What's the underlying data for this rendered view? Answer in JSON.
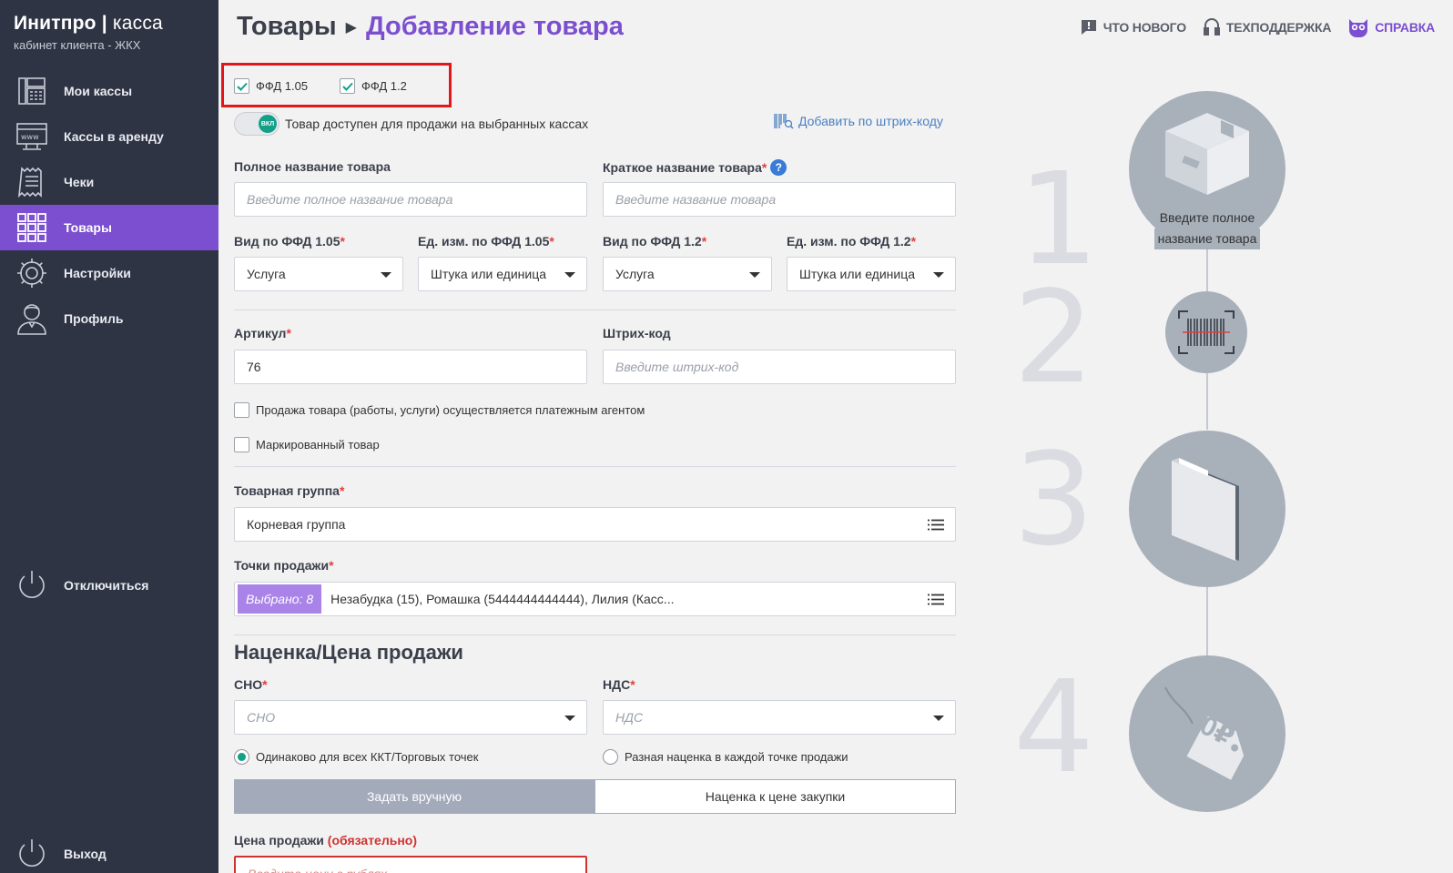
{
  "brand": {
    "name_bold": "Инитпро",
    "name_sep": "|",
    "name_thin": "касса",
    "subtitle": "кабинет клиента - ЖКХ"
  },
  "sidebar": {
    "items": [
      {
        "label": "Мои кассы",
        "icon": "cash-register-icon"
      },
      {
        "label": "Кассы в аренду",
        "icon": "www-terminal-icon"
      },
      {
        "label": "Чеки",
        "icon": "receipt-icon"
      },
      {
        "label": "Товары",
        "icon": "grid-icon",
        "active": true
      },
      {
        "label": "Настройки",
        "icon": "gear-icon"
      },
      {
        "label": "Профиль",
        "icon": "user-icon"
      }
    ],
    "disconnect": "Отключиться",
    "logout": "Выход"
  },
  "header": {
    "crumb_parent": "Товары",
    "crumb_current": "Добавление товара",
    "links": {
      "whats_new": "ЧТО НОВОГО",
      "support": "ТЕХПОДДЕРЖКА",
      "help": "СПРАВКА"
    }
  },
  "form": {
    "ffd105": {
      "label": "ФФД 1.05",
      "checked": true
    },
    "ffd12": {
      "label": "ФФД 1.2",
      "checked": true
    },
    "toggle_state": "ВКЛ",
    "toggle_label": "Товар доступен для продажи на выбранных кассах",
    "barcode_add": "Добавить по штрих-коду",
    "full_name": {
      "label": "Полное название товара",
      "placeholder": "Введите полное название товара"
    },
    "short_name": {
      "label": "Краткое название товара",
      "placeholder": "Введите название товара"
    },
    "kind105": {
      "label": "Вид по ФФД 1.05",
      "value": "Услуга"
    },
    "unit105": {
      "label": "Ед. изм. по ФФД 1.05",
      "value": "Штука или единица"
    },
    "kind12": {
      "label": "Вид по ФФД 1.2",
      "value": "Услуга"
    },
    "unit12": {
      "label": "Ед. изм. по ФФД 1.2",
      "value": "Штука или единица"
    },
    "article": {
      "label": "Артикул",
      "value": "76"
    },
    "barcode": {
      "label": "Штрих-код",
      "placeholder": "Введите штрих-код"
    },
    "agent_cb": "Продажа товара (работы, услуги) осуществляется платежным агентом",
    "marked_cb": "Маркированный товар",
    "group": {
      "label": "Товарная группа",
      "value": "Корневая группа"
    },
    "points": {
      "label": "Точки продажи",
      "chip": "Выбрано: 8",
      "value": "Незабудка (15), Ромашка (5444444444444), Лилия (Касс..."
    },
    "pricing_title": "Наценка/Цена продажи",
    "sno": {
      "label": "СНО",
      "placeholder": "СНО"
    },
    "nds": {
      "label": "НДС",
      "placeholder": "НДС"
    },
    "radio_same": "Одинаково для всех ККТ/Торговых точек",
    "radio_diff": "Разная наценка в каждой точке продажи",
    "seg_manual": "Задать вручную",
    "seg_markup": "Наценка к цене закупки",
    "price_label": "Цена продажи",
    "price_required": "(обязательно)",
    "price_placeholder": "Введите цену в рублях"
  },
  "illustration": {
    "steps": [
      "1",
      "2",
      "3",
      "4"
    ],
    "step1_caption_line1": "Введите полное",
    "step1_caption_line2": "название товара",
    "price_tag": "0₽"
  },
  "colors": {
    "accent": "#7b4fcf",
    "sidebar": "#2f3444",
    "teal": "#13a088",
    "required": "#e0403c"
  }
}
